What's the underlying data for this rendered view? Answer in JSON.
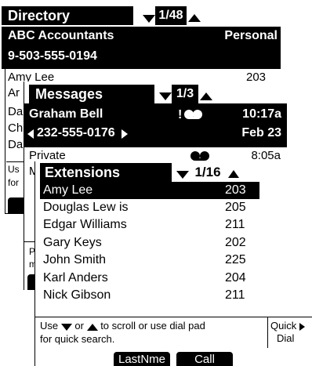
{
  "directory": {
    "title": "Directory",
    "pager": "1/48",
    "selected_name": "ABC Accountants",
    "selected_type": "Personal",
    "selected_phone": "9-503-555-0194",
    "row1_name": "Amy Lee",
    "row1_ext": "203",
    "partial_rows": [
      "Ar",
      "Da",
      "Ch",
      "Da"
    ],
    "hint_partial": [
      "Us",
      "for"
    ]
  },
  "messages": {
    "title": "Messages",
    "pager": "1/3",
    "caller_name": "Graham Bell",
    "caller_time": "10:17a",
    "caller_phone": "232-555-0176",
    "caller_date": "Feb 23",
    "private_label": "Private",
    "private_time": "8:05a",
    "partial_rows": [
      "M"
    ],
    "hint_partial": [
      "Pr",
      "me"
    ]
  },
  "extensions": {
    "title": "Extensions",
    "pager": "1/16",
    "rows": [
      {
        "name": "Amy Lee",
        "ext": "203"
      },
      {
        "name": "Douglas Lew is",
        "ext": "205"
      },
      {
        "name": "Edgar Williams",
        "ext": "211"
      },
      {
        "name": "Gary Keys",
        "ext": "202"
      },
      {
        "name": "John Smith",
        "ext": "225"
      },
      {
        "name": "Karl Anders",
        "ext": "204"
      },
      {
        "name": "Nick Gibson",
        "ext": "211"
      }
    ],
    "hint_use": "Use",
    "hint_or": "or",
    "hint_scroll": "to scroll or use dial pad",
    "hint_line2": "for quick search.",
    "quick_label": "Quick",
    "dial_label": "Dial",
    "softkey_lastname": "LastNme",
    "softkey_call": "Call"
  },
  "icons": {
    "down": "triangle-down",
    "up": "triangle-up",
    "voicemail": "voicemail-icon",
    "arrow_left": "left-arrow",
    "arrow_right": "right-arrow"
  }
}
